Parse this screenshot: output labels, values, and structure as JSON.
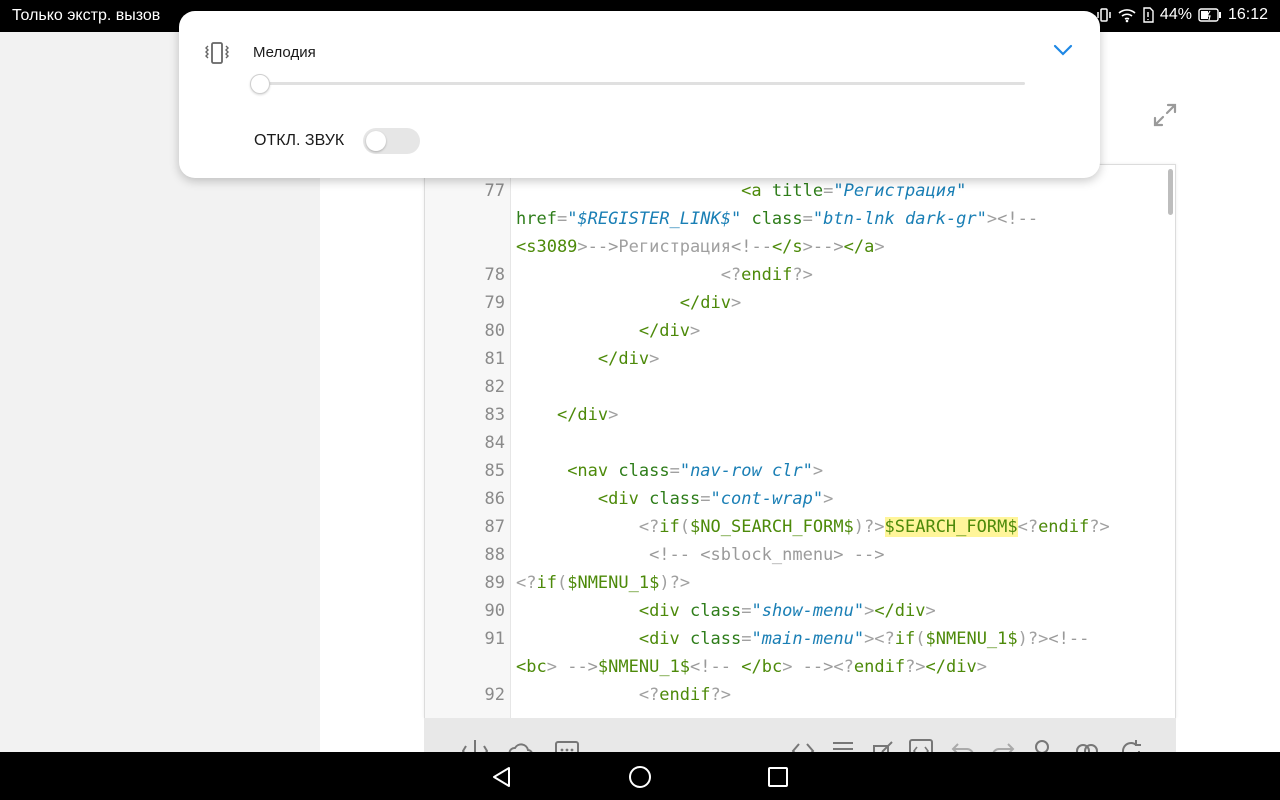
{
  "status_bar": {
    "carrier_text": "Только экстр. вызов",
    "battery": "44%",
    "time": "16:12"
  },
  "volume_panel": {
    "ringtone_label": "Мелодия",
    "mute_label": "ОТКЛ. ЗВУК",
    "volume_level": 0,
    "mute_enabled": false
  },
  "editor": {
    "lines": [
      {
        "no": "77",
        "html": "                      <span class=\"t\">&lt;a</span> <span class=\"a\">title</span>=<span class=\"s\">\"Регистрация\"</span>"
      },
      {
        "no": "",
        "html": "<span class=\"a\">href</span>=<span class=\"s\">\"$REGISTER_LINK$\"</span> <span class=\"a\">class</span>=<span class=\"s\">\"btn-lnk dark-gr\"</span>&gt;<span class=\"c\">&lt;!--</span>"
      },
      {
        "no": "",
        "html": "<span class=\"t\">&lt;s3089</span>&gt;<span class=\"c\">--&gt;</span>Регистрация<span class=\"c\">&lt;!--</span><span class=\"t\">&lt;/s</span>&gt;<span class=\"c\">--&gt;</span><span class=\"t\">&lt;/a</span>&gt;"
      },
      {
        "no": "78",
        "html": "                    &lt;?<span class=\"t\">endif</span>?&gt;"
      },
      {
        "no": "79",
        "html": "                <span class=\"t\">&lt;/div</span>&gt;"
      },
      {
        "no": "80",
        "html": "            <span class=\"t\">&lt;/div</span>&gt;"
      },
      {
        "no": "81",
        "html": "        <span class=\"t\">&lt;/div</span>&gt;"
      },
      {
        "no": "82",
        "html": ""
      },
      {
        "no": "83",
        "html": "    <span class=\"t\">&lt;/div</span>&gt;"
      },
      {
        "no": "84",
        "html": ""
      },
      {
        "no": "85",
        "html": "     <span class=\"t\">&lt;nav</span> <span class=\"a\">class</span>=<span class=\"s\">\"nav-row clr\"</span>&gt;"
      },
      {
        "no": "86",
        "html": "        <span class=\"t\">&lt;div</span> <span class=\"a\">class</span>=<span class=\"s\">\"cont-wrap\"</span>&gt;"
      },
      {
        "no": "87",
        "html": "            &lt;?<span class=\"t\">if</span>(<span class=\"v\">$NO_SEARCH_FORM$</span>)?&gt;<span class=\"v hl\">$SEARCH_FORM$</span>&lt;?<span class=\"t\">endif</span>?&gt;"
      },
      {
        "no": "88",
        "html": "             <span class=\"c\">&lt;!-- &lt;sblock_nmenu&gt; --&gt;</span>"
      },
      {
        "no": "89",
        "html": "&lt;?<span class=\"t\">if</span>(<span class=\"v\">$NMENU_1$</span>)?&gt;"
      },
      {
        "no": "90",
        "html": "            <span class=\"t\">&lt;div</span> <span class=\"a\">class</span>=<span class=\"s\">\"show-menu\"</span>&gt;<span class=\"t\">&lt;/div</span>&gt;"
      },
      {
        "no": "91",
        "html": "            <span class=\"t\">&lt;div</span> <span class=\"a\">class</span>=<span class=\"s\">\"main-menu\"</span>&gt;&lt;?<span class=\"t\">if</span>(<span class=\"v\">$NMENU_1$</span>)?&gt;<span class=\"c\">&lt;!--</span>"
      },
      {
        "no": "",
        "html": "<span class=\"t\">&lt;bc</span>&gt; <span class=\"c\">--&gt;</span><span class=\"v\">$NMENU_1$</span><span class=\"c\">&lt;!-- </span><span class=\"t\">&lt;/bc</span>&gt; <span class=\"c\">--&gt;</span>&lt;?<span class=\"t\">endif</span>?&gt;<span class=\"t\">&lt;/div</span>&gt;"
      },
      {
        "no": "92",
        "html": "            &lt;?<span class=\"t\">endif</span>?&gt;"
      }
    ]
  },
  "icons": {
    "vibrate": "vibrate-icon",
    "chevron": "chevron-down-icon",
    "expand": "expand-icon",
    "accent_color": "#1e88e5"
  }
}
